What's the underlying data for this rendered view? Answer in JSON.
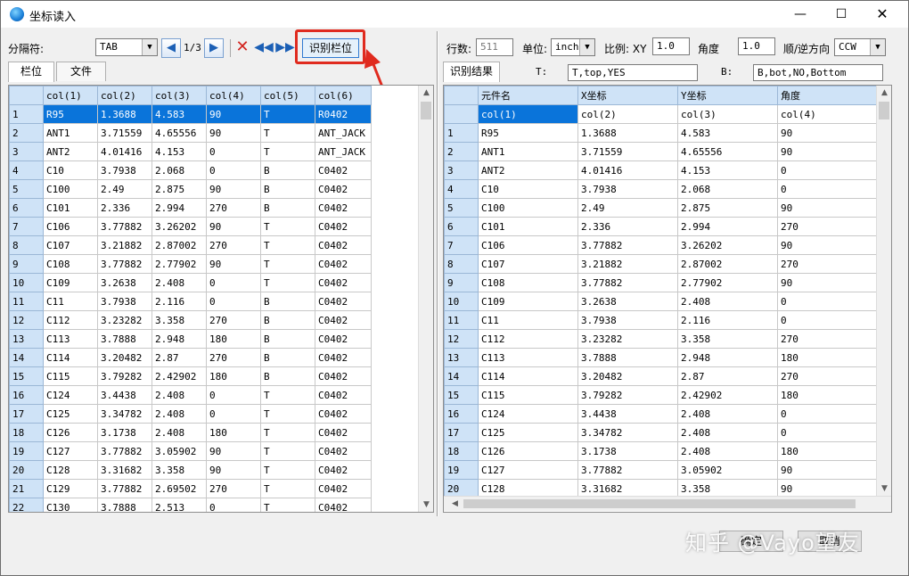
{
  "window": {
    "title": "坐标读入"
  },
  "toolbar": {
    "separator_label": "分隔符:",
    "separator_value": "TAB",
    "page_indicator": "1/3",
    "detect_button": "识别栏位"
  },
  "left_tabs": [
    "栏位",
    "文件"
  ],
  "left_table": {
    "headers": [
      "col(1)",
      "col(2)",
      "col(3)",
      "col(4)",
      "col(5)",
      "col(6)"
    ],
    "rows": [
      [
        "1",
        "R95",
        "1.3688",
        "4.583",
        "90",
        "T",
        "R0402"
      ],
      [
        "2",
        "ANT1",
        "3.71559",
        "4.65556",
        "90",
        "T",
        "ANT_JACK"
      ],
      [
        "3",
        "ANT2",
        "4.01416",
        "4.153",
        "0",
        "T",
        "ANT_JACK"
      ],
      [
        "4",
        "C10",
        "3.7938",
        "2.068",
        "0",
        "B",
        "C0402"
      ],
      [
        "5",
        "C100",
        "2.49",
        "2.875",
        "90",
        "B",
        "C0402"
      ],
      [
        "6",
        "C101",
        "2.336",
        "2.994",
        "270",
        "B",
        "C0402"
      ],
      [
        "7",
        "C106",
        "3.77882",
        "3.26202",
        "90",
        "T",
        "C0402"
      ],
      [
        "8",
        "C107",
        "3.21882",
        "2.87002",
        "270",
        "T",
        "C0402"
      ],
      [
        "9",
        "C108",
        "3.77882",
        "2.77902",
        "90",
        "T",
        "C0402"
      ],
      [
        "10",
        "C109",
        "3.2638",
        "2.408",
        "0",
        "T",
        "C0402"
      ],
      [
        "11",
        "C11",
        "3.7938",
        "2.116",
        "0",
        "B",
        "C0402"
      ],
      [
        "12",
        "C112",
        "3.23282",
        "3.358",
        "270",
        "B",
        "C0402"
      ],
      [
        "13",
        "C113",
        "3.7888",
        "2.948",
        "180",
        "B",
        "C0402"
      ],
      [
        "14",
        "C114",
        "3.20482",
        "2.87",
        "270",
        "B",
        "C0402"
      ],
      [
        "15",
        "C115",
        "3.79282",
        "2.42902",
        "180",
        "B",
        "C0402"
      ],
      [
        "16",
        "C124",
        "3.4438",
        "2.408",
        "0",
        "T",
        "C0402"
      ],
      [
        "17",
        "C125",
        "3.34782",
        "2.408",
        "0",
        "T",
        "C0402"
      ],
      [
        "18",
        "C126",
        "3.1738",
        "2.408",
        "180",
        "T",
        "C0402"
      ],
      [
        "19",
        "C127",
        "3.77882",
        "3.05902",
        "90",
        "T",
        "C0402"
      ],
      [
        "20",
        "C128",
        "3.31682",
        "3.358",
        "90",
        "T",
        "C0402"
      ],
      [
        "21",
        "C129",
        "3.77882",
        "2.69502",
        "270",
        "T",
        "C0402"
      ],
      [
        "22",
        "C130",
        "3.7888",
        "2.513",
        "0",
        "T",
        "C0402"
      ]
    ]
  },
  "right_top": {
    "rows_label": "行数:",
    "rows_value": "511",
    "unit_label": "单位:",
    "unit_value": "inch",
    "scale_label": "比例: XY",
    "scale_value": "1.0",
    "angle_label": "角度",
    "angle_value": "1.0",
    "direction_label": "顺/逆方向",
    "direction_value": "CCW"
  },
  "right_tab": "识别结果",
  "side_filters": {
    "top_label": "T:",
    "top_value": "T,top,YES",
    "bottom_label": "B:",
    "bottom_value": "B,bot,NO,Bottom"
  },
  "right_table": {
    "headers": [
      "",
      "元件名",
      "X坐标",
      "Y坐标",
      "角度"
    ],
    "mapping_row": [
      "",
      "col(1)",
      "col(2)",
      "col(3)",
      "col(4)"
    ],
    "rows": [
      [
        "1",
        "R95",
        "1.3688",
        "4.583",
        "90"
      ],
      [
        "2",
        "ANT1",
        "3.71559",
        "4.65556",
        "90"
      ],
      [
        "3",
        "ANT2",
        "4.01416",
        "4.153",
        "0"
      ],
      [
        "4",
        "C10",
        "3.7938",
        "2.068",
        "0"
      ],
      [
        "5",
        "C100",
        "2.49",
        "2.875",
        "90"
      ],
      [
        "6",
        "C101",
        "2.336",
        "2.994",
        "270"
      ],
      [
        "7",
        "C106",
        "3.77882",
        "3.26202",
        "90"
      ],
      [
        "8",
        "C107",
        "3.21882",
        "2.87002",
        "270"
      ],
      [
        "9",
        "C108",
        "3.77882",
        "2.77902",
        "90"
      ],
      [
        "10",
        "C109",
        "3.2638",
        "2.408",
        "0"
      ],
      [
        "11",
        "C11",
        "3.7938",
        "2.116",
        "0"
      ],
      [
        "12",
        "C112",
        "3.23282",
        "3.358",
        "270"
      ],
      [
        "13",
        "C113",
        "3.7888",
        "2.948",
        "180"
      ],
      [
        "14",
        "C114",
        "3.20482",
        "2.87",
        "270"
      ],
      [
        "15",
        "C115",
        "3.79282",
        "2.42902",
        "180"
      ],
      [
        "16",
        "C124",
        "3.4438",
        "2.408",
        "0"
      ],
      [
        "17",
        "C125",
        "3.34782",
        "2.408",
        "0"
      ],
      [
        "18",
        "C126",
        "3.1738",
        "2.408",
        "180"
      ],
      [
        "19",
        "C127",
        "3.77882",
        "3.05902",
        "90"
      ],
      [
        "20",
        "C128",
        "3.31682",
        "3.358",
        "90"
      ]
    ]
  },
  "footer": {
    "ok_button": "确定",
    "cancel_button": "取消"
  },
  "watermark": "知乎 @Vayo望友",
  "colors": {
    "highlight": "#e02b1f",
    "selection": "#0a74da",
    "header": "#cfe3f7"
  },
  "icons": {
    "app": "globe-icon",
    "minimize": "minimize-icon",
    "maximize": "maximize-icon",
    "close": "close-icon",
    "prev": "prev-icon",
    "next": "next-icon",
    "delete": "delete-x-icon",
    "rewind": "rewind-icon",
    "forward": "fast-forward-icon"
  }
}
